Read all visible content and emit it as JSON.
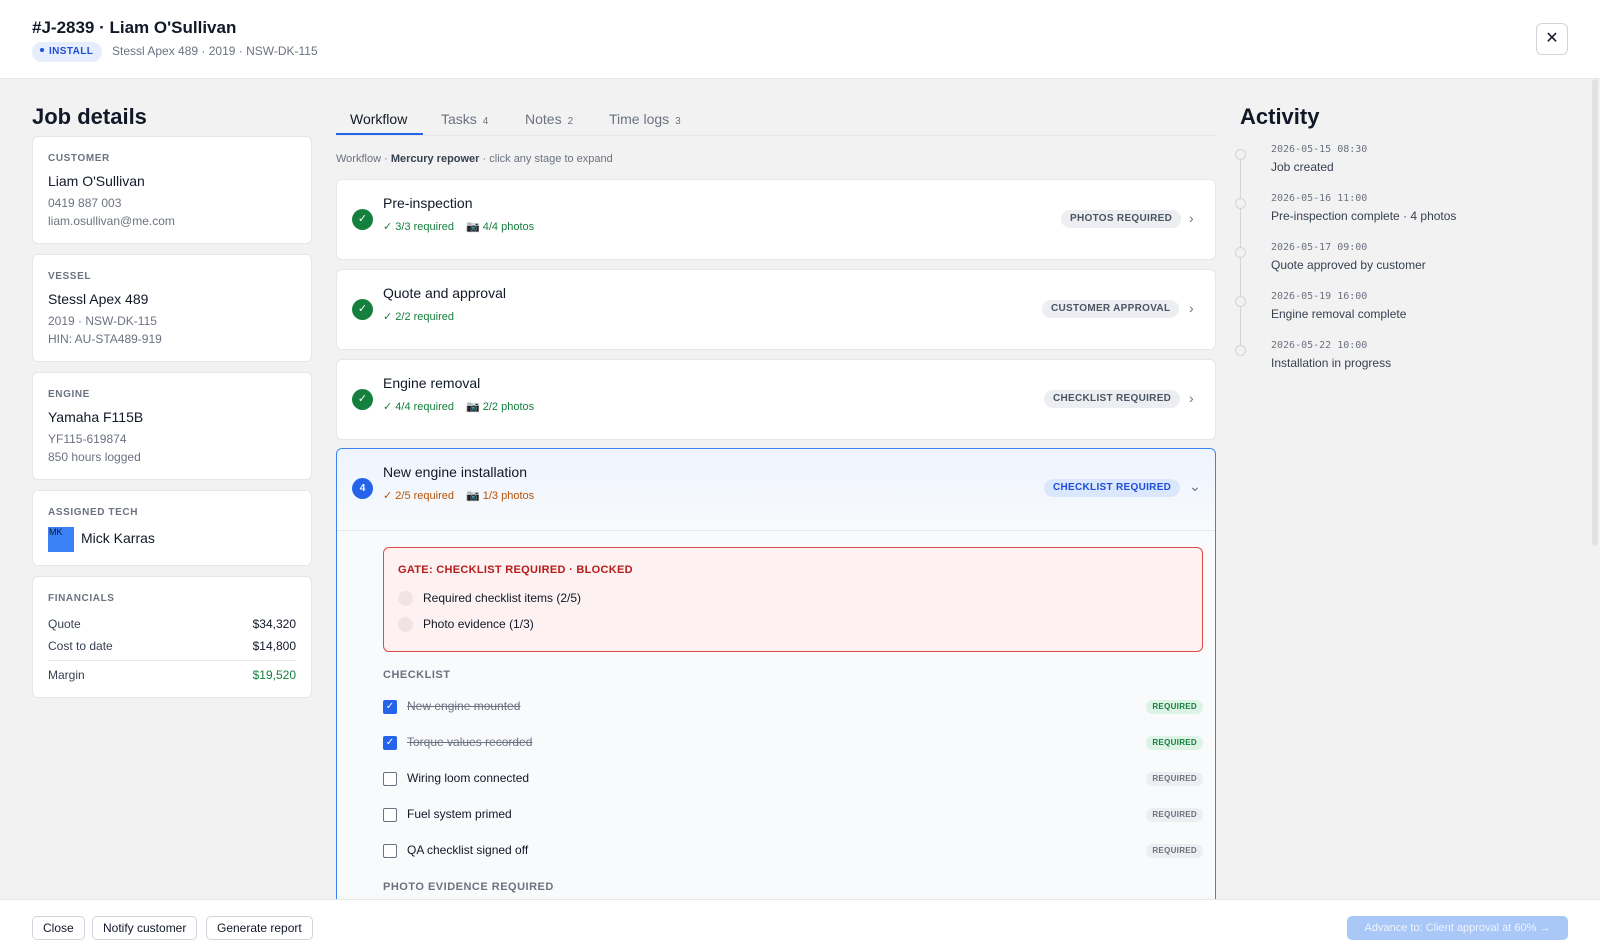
{
  "header": {
    "job_title": "#J-2839 · Liam O'Sullivan",
    "type_badge": "INSTALL",
    "vessel_line": "Stessl Apex 489 · 2019 · NSW-DK-115",
    "close_glyph": "✕"
  },
  "job_details": {
    "heading": "Job details",
    "customer": {
      "label": "CUSTOMER",
      "name": "Liam O'Sullivan",
      "phone": "0419 887 003",
      "email": "liam.osullivan@me.com"
    },
    "vessel": {
      "label": "VESSEL",
      "name": "Stessl Apex 489",
      "line1": "2019 · NSW-DK-115",
      "line2": "HIN: AU-STA489-919"
    },
    "engine": {
      "label": "ENGINE",
      "name": "Yamaha F115B",
      "line1": "YF115-619874",
      "line2": "850 hours logged"
    },
    "tech": {
      "label": "ASSIGNED TECH",
      "initials": "MK",
      "name": "Mick Karras",
      "avatar_color": "#3b82f6"
    },
    "financials": {
      "label": "FINANCIALS",
      "rows": [
        {
          "label": "Quote",
          "value": "$34,320"
        },
        {
          "label": "Cost to date",
          "value": "$14,800"
        },
        {
          "label": "Margin",
          "value": "$19,520",
          "color": "#15803d"
        }
      ]
    }
  },
  "tabs": [
    {
      "label": "Workflow",
      "count": ""
    },
    {
      "label": "Tasks",
      "count": "4"
    },
    {
      "label": "Notes",
      "count": "2"
    },
    {
      "label": "Time logs",
      "count": "3"
    }
  ],
  "workflow": {
    "caption_prefix": "Workflow · ",
    "caption_name": "Mercury repower",
    "caption_suffix": " · click any stage to expand",
    "stages": [
      {
        "name": "Pre-inspection",
        "required": "✓ 3/3 required",
        "photos": "📷 4/4 photos",
        "gate": "PHOTOS REQUIRED",
        "status": "complete",
        "icon": "check-circle-icon"
      },
      {
        "name": "Quote and approval",
        "required": "✓ 2/2 required",
        "photos": "",
        "gate": "CUSTOMER APPROVAL",
        "status": "complete",
        "icon": "check-circle-icon"
      },
      {
        "name": "Engine removal",
        "required": "✓ 4/4 required",
        "photos": "📷 2/2 photos",
        "gate": "CHECKLIST REQUIRED",
        "status": "complete",
        "icon": "check-circle-icon"
      }
    ],
    "active_stage": {
      "number": "4",
      "name": "New engine installation",
      "required": "✓ 2/5 required",
      "photos": "📷 1/3 photos",
      "gate": "CHECKLIST REQUIRED",
      "gate_box": {
        "title": "GATE: CHECKLIST REQUIRED · BLOCKED",
        "items": [
          "Required checklist items (2/5)",
          "Photo evidence (1/3)"
        ]
      },
      "checklist_heading": "CHECKLIST",
      "checklist": [
        {
          "label": "New engine mounted",
          "checked": true,
          "tag": "REQUIRED"
        },
        {
          "label": "Torque values recorded",
          "checked": true,
          "tag": "REQUIRED"
        },
        {
          "label": "Wiring loom connected",
          "checked": false,
          "tag": "REQUIRED"
        },
        {
          "label": "Fuel system primed",
          "checked": false,
          "tag": "REQUIRED"
        },
        {
          "label": "QA checklist signed off",
          "checked": false,
          "tag": "REQUIRED"
        }
      ],
      "photo_heading": "PHOTO EVIDENCE REQUIRED"
    }
  },
  "activity": {
    "heading": "Activity",
    "items": [
      {
        "time": "2026-05-15 08:30",
        "text": "Job created"
      },
      {
        "time": "2026-05-16 11:00",
        "text": "Pre-inspection complete · 4 photos"
      },
      {
        "time": "2026-05-17 09:00",
        "text": "Quote approved by customer"
      },
      {
        "time": "2026-05-19 16:00",
        "text": "Engine removal complete"
      },
      {
        "time": "2026-05-22 10:00",
        "text": "Installation in progress"
      }
    ]
  },
  "footer": {
    "close_label": "Close",
    "notify_label": "Notify customer",
    "report_label": "Generate report",
    "advance_label": "Advance to: Client approval at 60% →"
  },
  "colors": {
    "accent": "#2563eb",
    "success": "#15803d",
    "warning": "#b45309",
    "danger": "#b91c1c"
  }
}
